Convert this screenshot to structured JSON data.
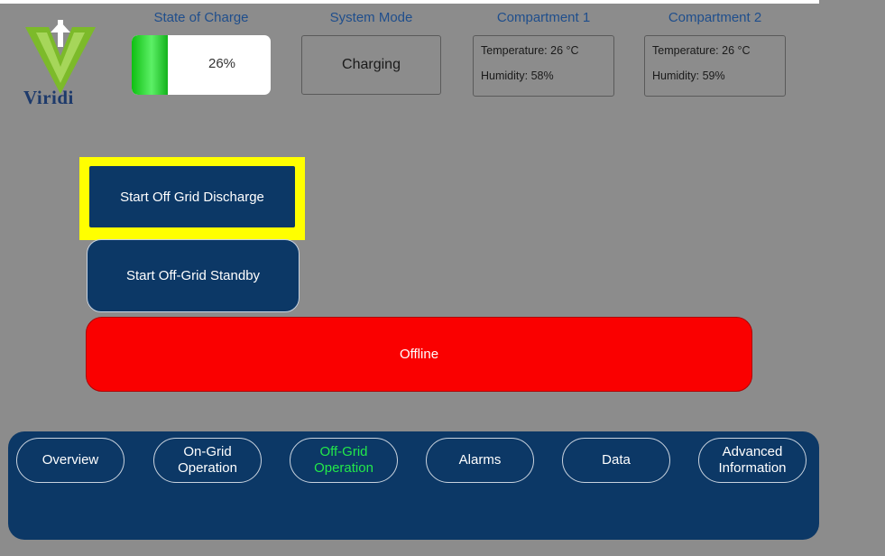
{
  "brand": {
    "name": "Viridi",
    "logo_color": "#7cba2a"
  },
  "header": {
    "soc_label": "State of Charge",
    "mode_label": "System Mode",
    "comp1_label": "Compartment 1",
    "comp2_label": "Compartment 2"
  },
  "status": {
    "soc_value": "26%",
    "soc_fraction": 0.26,
    "system_mode": "Charging",
    "compartment1": {
      "temperature": "Temperature: 26 °C",
      "humidity": "Humidity: 58%"
    },
    "compartment2": {
      "temperature": "Temperature: 26 °C",
      "humidity": "Humidity: 59%"
    }
  },
  "actions": {
    "discharge_label": "Start Off Grid Discharge",
    "standby_label": "Start Off-Grid Standby",
    "offline_label": "Offline"
  },
  "nav": {
    "items": [
      {
        "label": "Overview",
        "active": false
      },
      {
        "label": "On-Grid\nOperation",
        "active": false
      },
      {
        "label": "Off-Grid\nOperation",
        "active": true
      },
      {
        "label": "Alarms",
        "active": false
      },
      {
        "label": "Data",
        "active": false
      },
      {
        "label": "Advanced\nInformation",
        "active": false
      }
    ]
  },
  "colors": {
    "panel": "#8c8c8c",
    "button_navy": "#0c3866",
    "offline_red": "#fa0000",
    "highlight_yellow": "#ffff00",
    "active_nav_text": "#22e84a",
    "header_label": "#1f4e8c"
  }
}
